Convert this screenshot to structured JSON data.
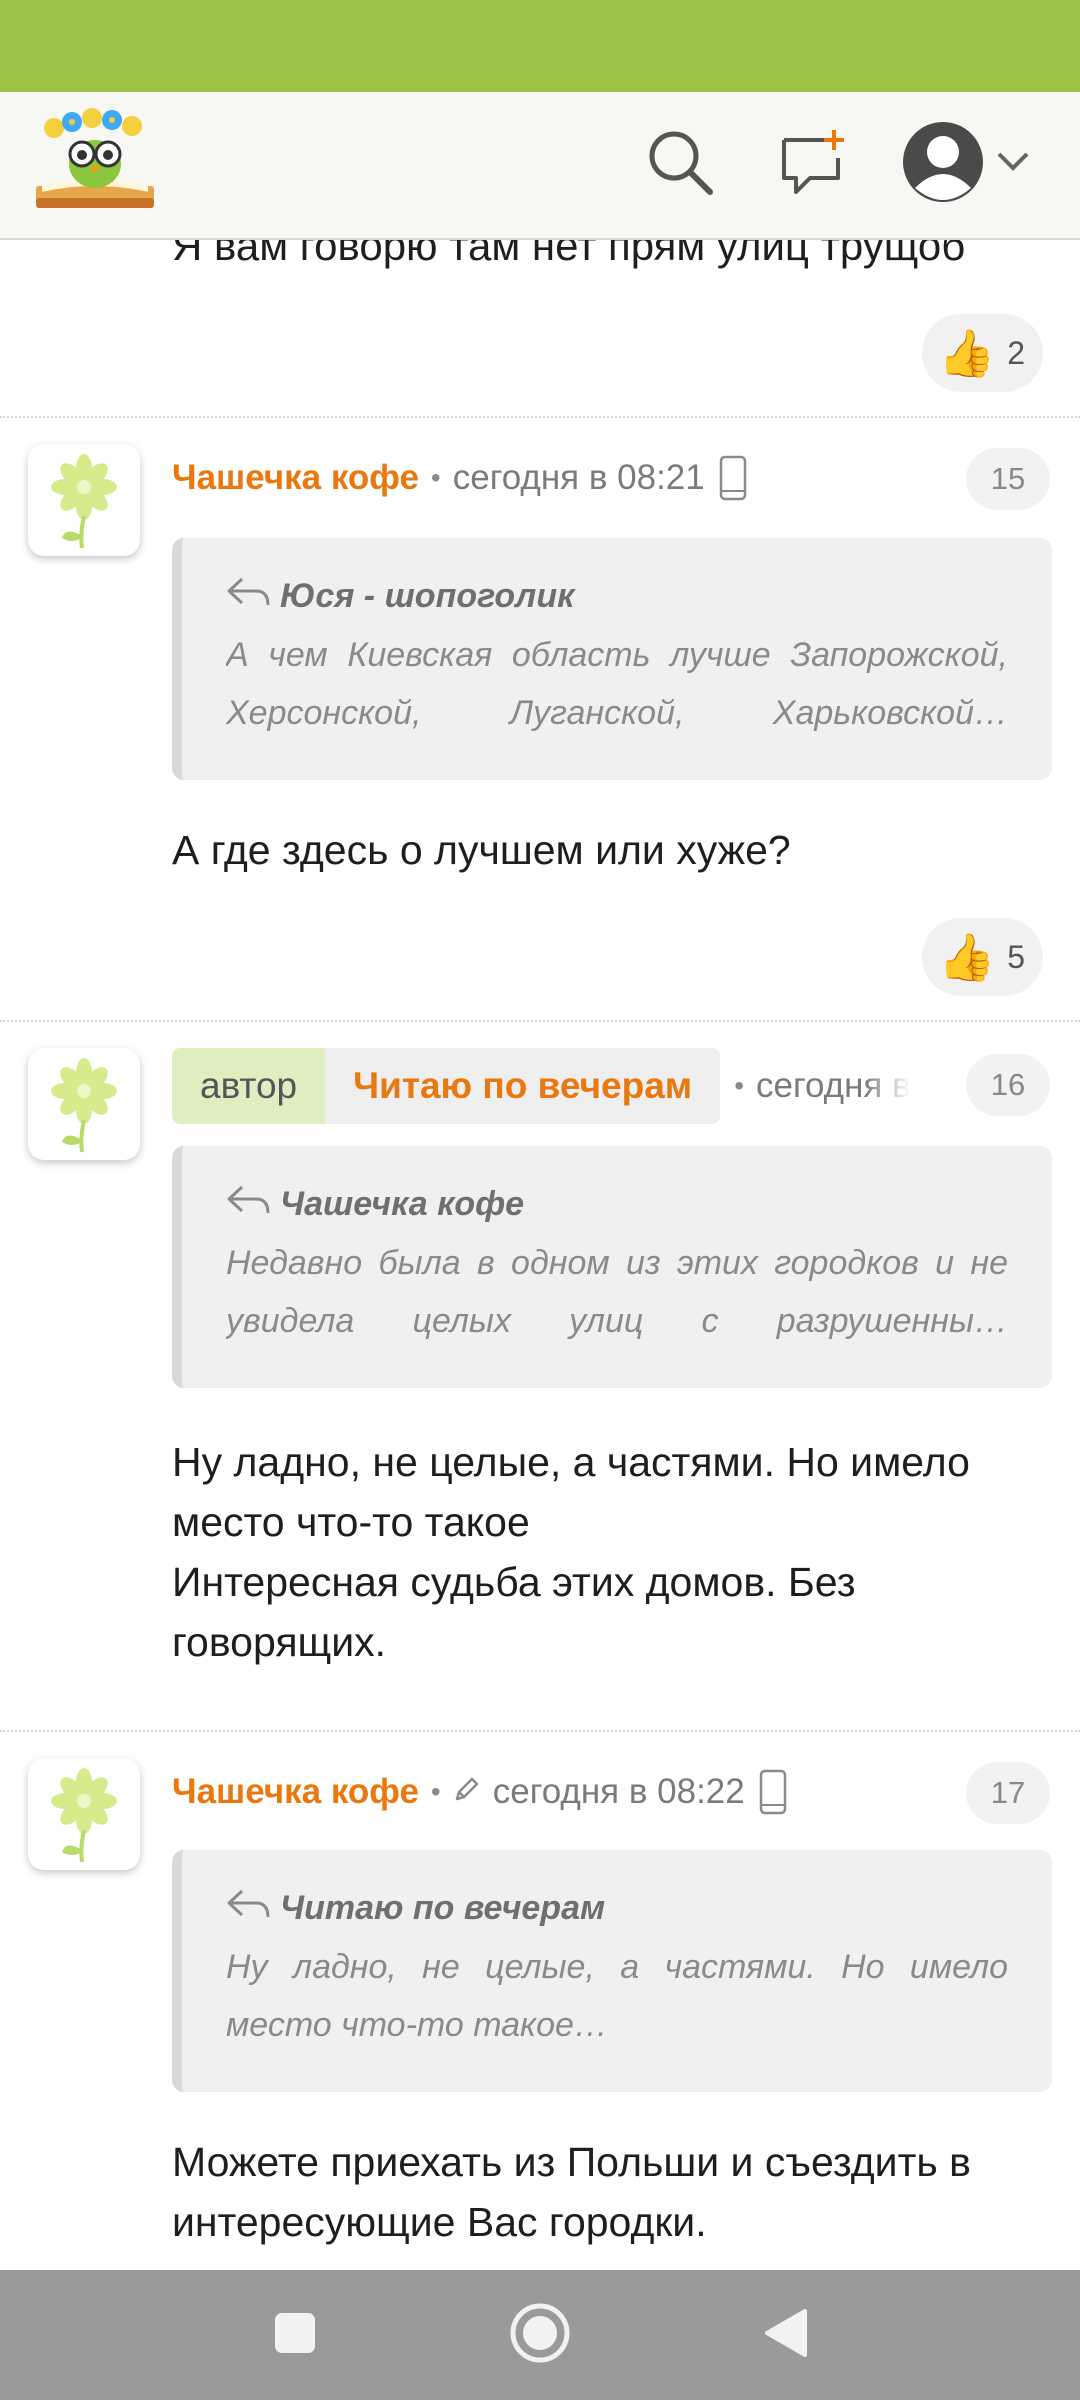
{
  "header": {
    "logo": "owl-reading-book-logo",
    "icons": [
      "search-icon",
      "new-comment-icon",
      "profile-icon",
      "chevron-down-icon"
    ]
  },
  "top": {
    "text": "Я вам говорю там нет прям улиц трущоб",
    "likes": "2"
  },
  "comments": [
    {
      "author": "Чашечка кофе",
      "time": "сегодня в 08:21",
      "number": "15",
      "quote_author": "Юся - шопоголик",
      "quote_lines": [
        "А чем Киевская область лучше Запорожской,",
        "Херсонской, Луганской, Харьковской…"
      ],
      "text": "А где здесь о лучшем или хуже?",
      "likes": "5"
    },
    {
      "badge": "автор",
      "author": "Читаю по вечерам",
      "time": "сегодня в",
      "number": "16",
      "quote_author": "Чашечка кофе",
      "quote_lines": [
        "Недавно была в одном из этих городков и не",
        "увидела целых улиц с разрушенны…"
      ],
      "text_lines": [
        "Ну ладно, не целые, а частями. Но имело",
        "место что-то такое",
        "Интересная судьба этих домов. Без",
        "говорящих."
      ]
    },
    {
      "author": "Чашечка кофе",
      "time": "сегодня в 08:22",
      "number": "17",
      "quote_author": "Читаю по вечерам",
      "quote_lines": [
        "Ну ладно, не целые, а частями. Но имело",
        "место что-то такое…"
      ],
      "text_lines": [
        "Можете приехать из Польши и съездить в",
        "интересующие Вас городки."
      ]
    }
  ],
  "colors": {
    "status_bar": "#9dc245",
    "author": "#e8780f",
    "author_badge": "#dfeec0",
    "nav_bar": "#9a9a9a"
  }
}
